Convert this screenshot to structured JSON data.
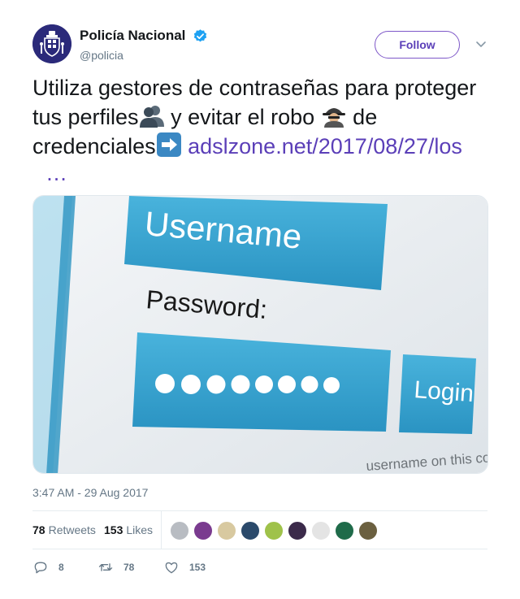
{
  "author": {
    "name": "Policía Nacional",
    "handle": "@policia",
    "verified": true
  },
  "follow_label": "Follow",
  "tweet": {
    "part1": "Utiliza gestores de contraseñas para proteger tus perfiles",
    "part2": " y evitar el robo",
    "part3": " de credenciales",
    "link": "adslzone.net/2017/08/27/los",
    "ellipsis": "…"
  },
  "image": {
    "username_label": "Username",
    "password_label": "Password:",
    "login_label": "Login",
    "footer_text": "username on this compu"
  },
  "timestamp": "3:47 AM - 29 Aug 2017",
  "stats": {
    "retweets_count": "78",
    "retweets_label": "Retweets",
    "likes_count": "153",
    "likes_label": "Likes"
  },
  "likers_colors": [
    "#b8bcc2",
    "#7a3b8f",
    "#d8c9a0",
    "#2b4a6b",
    "#9fc24a",
    "#3b2a4a",
    "#e4e4e4",
    "#1f6b4a",
    "#6b6040"
  ],
  "actions": {
    "reply_count": "8",
    "retweet_count": "78",
    "like_count": "153"
  },
  "colors": {
    "accent": "#5b3fb8",
    "verified": "#1da1f2",
    "muted": "#657786"
  }
}
